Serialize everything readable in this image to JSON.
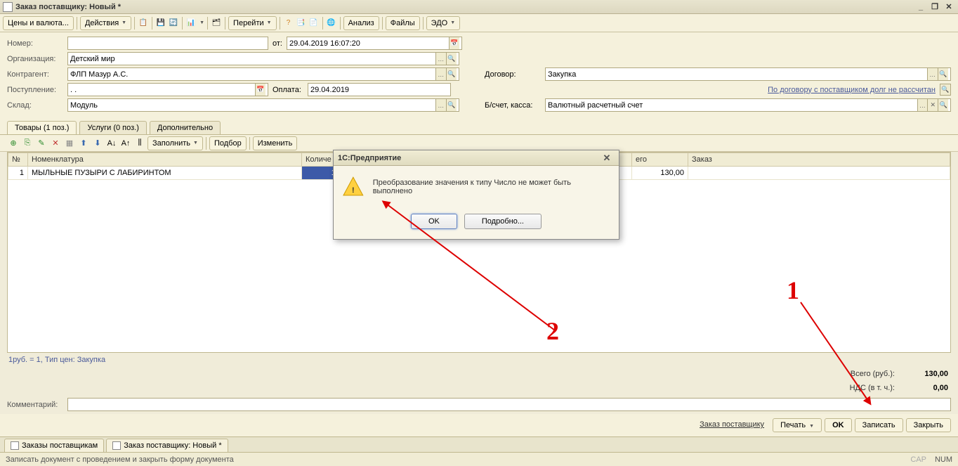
{
  "window": {
    "title": "Заказ поставщику: Новый *"
  },
  "toolbar": {
    "prices": "Цены и валюта...",
    "actions": "Действия",
    "goto": "Перейти",
    "analysis": "Анализ",
    "files": "Файлы",
    "edo": "ЭДО"
  },
  "form": {
    "number_label": "Номер:",
    "date_label": "от:",
    "date_value": "29.04.2019 16:07:20",
    "org_label": "Организация:",
    "org_value": "Детский мир",
    "counterparty_label": "Контрагент:",
    "counterparty_value": "ФЛП Мазур А.С.",
    "contract_label": "Договор:",
    "contract_value": "Закупка",
    "receipt_label": "Поступление:",
    "receipt_value": ". .",
    "payment_label": "Оплата:",
    "payment_value": "29.04.2019",
    "debt_link": "По договору с поставщиком долг не рассчитан",
    "warehouse_label": "Склад:",
    "warehouse_value": "Модуль",
    "account_label": "Б/счет, касса:",
    "account_value": "Валютный расчетный счет"
  },
  "tabs": {
    "goods": "Товары (1 поз.)",
    "services": "Услуги (0 поз.)",
    "extra": "Дополнительно"
  },
  "table_toolbar": {
    "fill": "Заполнить",
    "select": "Подбор",
    "change": "Изменить"
  },
  "grid": {
    "headers": {
      "n": "№",
      "name": "Номенклатура",
      "qty": "Количе",
      "total": "его",
      "order": "Заказ"
    },
    "rows": [
      {
        "n": "1",
        "name": "МЫЛЬНЫЕ ПУЗЫРИ С ЛАБИРИНТОМ",
        "qty": "13",
        "total": "130,00",
        "order": ""
      }
    ]
  },
  "info_line": "1руб. = 1, Тип цен: Закупка",
  "totals": {
    "total_label": "Всего (руб.):",
    "total_value": "130,00",
    "vat_label": "НДС (в т. ч.):",
    "vat_value": "0,00"
  },
  "comment_label": "Комментарий:",
  "footer": {
    "order": "Заказ поставщику",
    "print": "Печать",
    "ok": "OK",
    "save": "Записать",
    "close": "Закрыть"
  },
  "doctabs": {
    "list": "Заказы поставщикам",
    "doc": "Заказ поставщику: Новый *"
  },
  "statusbar": {
    "hint": "Записать документ с проведением и закрыть форму документа",
    "cap": "CAP",
    "num": "NUM"
  },
  "dialog": {
    "title": "1С:Предприятие",
    "message": "Преобразование значения к типу Число не может быть выполнено",
    "ok": "OK",
    "details": "Подробно..."
  },
  "annotations": {
    "one": "1",
    "two": "2"
  }
}
